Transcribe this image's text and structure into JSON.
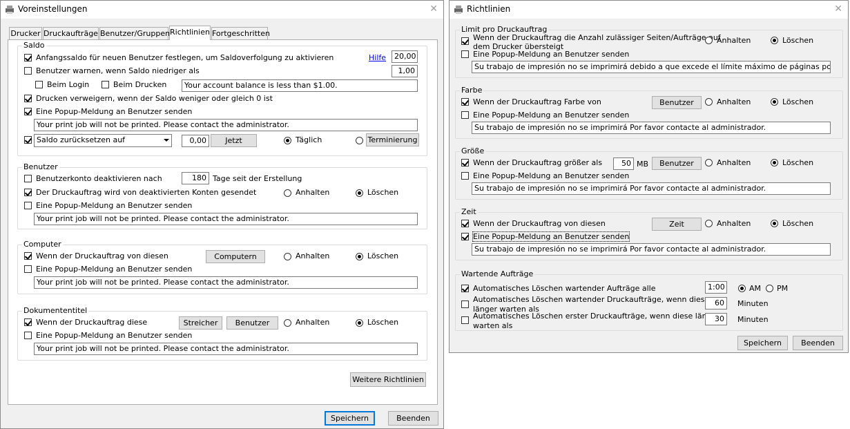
{
  "win1": {
    "title": "Voreinstellungen",
    "tabs": [
      "Drucker",
      "Druckaufträge",
      "Benutzer/Gruppen",
      "Richtlinien",
      "Fortgeschritten"
    ],
    "saldo": {
      "label": "Saldo",
      "initial_balance_label": "Anfangssaldo für neuen Benutzer festlegen, um Saldoverfolgung zu aktivieren",
      "help_link": "Hilfe",
      "initial_balance_value": "20,00",
      "warn_label": "Benutzer warnen, wenn Saldo niedriger als",
      "warn_value": "1,00",
      "at_login_label": "Beim Login",
      "at_print_label": "Beim Drucken",
      "warn_message": "Your account balance is less than $1.00.",
      "deny_label": "Drucken verweigern, wenn der Saldo weniger oder gleich 0 ist",
      "popup_label": "Eine Popup-Meldung an Benutzer senden",
      "popup_message": "Your print job will not be printed. Please contact the administrator.",
      "reset_select": "Saldo zurücksetzen auf",
      "reset_value": "0,00",
      "now_button": "Jetzt",
      "daily_label": "Täglich",
      "schedule_button": "Terminierung"
    },
    "benutzer": {
      "label": "Benutzer",
      "deactivate_label": "Benutzerkonto deaktivieren nach",
      "deactivate_days": "180",
      "days_suffix": "Tage seit der Erstellung",
      "job_from_label": "Der Druckauftrag wird von deaktivierten Konten gesendet",
      "hold_label": "Anhalten",
      "delete_label": "Löschen",
      "popup_label": "Eine Popup-Meldung an Benutzer senden",
      "popup_message": "Your print job will not be printed. Please contact the administrator."
    },
    "computer": {
      "label": "Computer",
      "job_from_label": "Wenn der Druckauftrag von diesen",
      "computers_button": "Computern",
      "hold_label": "Anhalten",
      "delete_label": "Löschen",
      "popup_label": "Eine Popup-Meldung an Benutzer senden",
      "popup_message": "Your print job will not be printed. Please contact the administrator."
    },
    "doctitle": {
      "label": "Dokumententitel",
      "job_label": "Wenn der Druckauftrag diese",
      "stripper_button": "Streicher",
      "users_button": "Benutzer",
      "hold_label": "Anhalten",
      "delete_label": "Löschen",
      "popup_label": "Eine Popup-Meldung an Benutzer senden",
      "popup_message": "Your print job will not be printed. Please contact the administrator."
    },
    "more_button": "Weitere Richtlinien",
    "save_button": "Speichern",
    "quit_button": "Beenden"
  },
  "win2": {
    "title": "Richtlinien",
    "limit": {
      "label": "Limit pro Druckauftrag",
      "exceed_label_1": "Wenn der Druckauftrag die Anzahl zulässiger Seiten/Aufträge auf",
      "exceed_label_2": "dem Drucker übersteigt",
      "hold_label": "Anhalten",
      "delete_label": "Löschen",
      "popup_label": "Eine Popup-Meldung an Benutzer senden",
      "popup_message": "Su trabajo de impresión no se imprimirá debido a que excede el límite máximo de páginas por trabajo permitido"
    },
    "color": {
      "label": "Farbe",
      "job_label": "Wenn der Druckauftrag Farbe von",
      "users_button": "Benutzer",
      "hold_label": "Anhalten",
      "delete_label": "Löschen",
      "popup_label": "Eine Popup-Meldung an Benutzer senden",
      "popup_message": "Su trabajo de impresión no se imprimirá Por favor contacte al administrador."
    },
    "size": {
      "label": "Größe",
      "job_label": "Wenn der Druckauftrag größer als",
      "size_value": "50",
      "unit": "MB",
      "users_button": "Benutzer",
      "hold_label": "Anhalten",
      "delete_label": "Löschen",
      "popup_label": "Eine Popup-Meldung an Benutzer senden",
      "popup_message": "Su trabajo de impresión no se imprimirá Por favor contacte al administrador."
    },
    "time": {
      "label": "Zeit",
      "job_label": "Wenn der Druckauftrag von diesen",
      "time_button": "Zeit",
      "hold_label": "Anhalten",
      "delete_label": "Löschen",
      "popup_label": "Eine Popup-Meldung an Benutzer senden",
      "popup_message": "Su trabajo de impresión no se imprimirá Por favor contacte al administrador."
    },
    "waiting": {
      "label": "Wartende Aufträge",
      "auto_delete_label": "Automatisches Löschen wartender Aufträge alle",
      "auto_delete_time": "1:00",
      "am_label": "AM",
      "pm_label": "PM",
      "auto_delete_longer_1": "Automatisches Löschen wartender Druckaufträge, wenn diese",
      "auto_delete_longer_2": "länger warten als",
      "longer_value": "60",
      "minutes_1": "Minuten",
      "auto_delete_first_1": "Automatisches Löschen erster Druckaufträge, wenn diese länger",
      "auto_delete_first_2": "warten als",
      "first_value": "30",
      "minutes_2": "Minuten"
    },
    "save_button": "Speichern",
    "quit_button": "Beenden"
  }
}
